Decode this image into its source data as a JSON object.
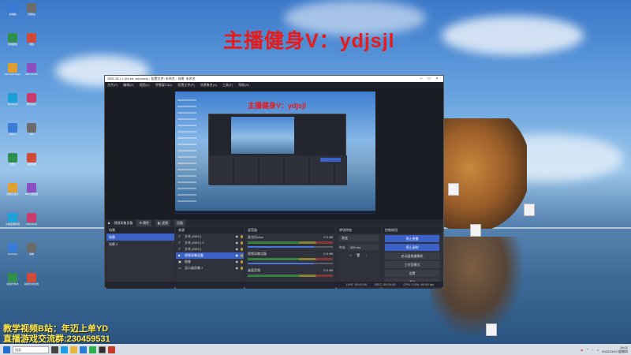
{
  "overlay": {
    "title": "主播健身V：ydjsjl",
    "line1": "教学视频B站：年迈上单YD",
    "line2": "直播游戏交流群:230459531"
  },
  "obs": {
    "window_title": "OBS 28.1.1 (64-bit, windows) - 配置文件: 未命名 - 场景: 未命名",
    "menu": [
      "文件(F)",
      "编辑(E)",
      "视图(V)",
      "停靠窗口(D)",
      "配置文件(P)",
      "场景集合(S)",
      "工具(T)",
      "帮助(H)"
    ],
    "preview_text": "主播健身V：ydjsjl",
    "source_toolbar": {
      "current_source": "视频采集设备",
      "properties": "属性",
      "filters": "滤镜",
      "device": "设备"
    },
    "scenes": {
      "header": "场景",
      "items": [
        "场景",
        "场景 2"
      ]
    },
    "sources": {
      "header": "来源",
      "items": [
        "文本 (GDI+)",
        "文本 (GDI+) 2",
        "文本 (GDI+)",
        "视频采集设备",
        "图像",
        "显示器采集 2"
      ]
    },
    "mixer": {
      "header": "混音器",
      "channels": [
        {
          "name": "麦克风/Aux",
          "db": "0.0 dB",
          "level": 0.78
        },
        {
          "name": "视频采集设备",
          "db": "0.0 dB",
          "level": 0.78
        },
        {
          "name": "桌面音频",
          "db": "0.0 dB",
          "level": 0.78
        }
      ]
    },
    "transitions": {
      "header": "转场特效",
      "type": "渐变",
      "duration_label": "时长",
      "duration": "300 ms"
    },
    "controls": {
      "header": "控制按钮",
      "buttons": [
        "停止直播",
        "停止录制",
        "启动虚拟摄像机",
        "工作室模式",
        "设置",
        "退出"
      ]
    },
    "status": {
      "live": "LIVE: 00:00:00",
      "rec": "REC: 00:00:00",
      "cpu": "CPU: 0.5%, 60.00 fps"
    }
  },
  "desktop_icons": [
    "此电脑",
    "回收站",
    "控制面板",
    "网络",
    "Microsoft Edge",
    "OBS Studio",
    "WeGame",
    "腾讯会议",
    "Steam",
    "QQ",
    "微信",
    "英雄联盟",
    "网易云音乐",
    "Bilibili直播姬",
    "斗鱼直播伴侣",
    "Photoshop",
    "Premiere",
    "剪映",
    "新建文件夹",
    "新建文本文档"
  ],
  "taskbar": {
    "search_placeholder": "搜索",
    "time": "16:01",
    "date": "2022/11/10 星期四"
  },
  "colors": {
    "accent": "#3a62c9",
    "overlay_red": "#e81a1a",
    "overlay_yellow": "#ffe94d",
    "obs_bg": "#2b2e38"
  }
}
